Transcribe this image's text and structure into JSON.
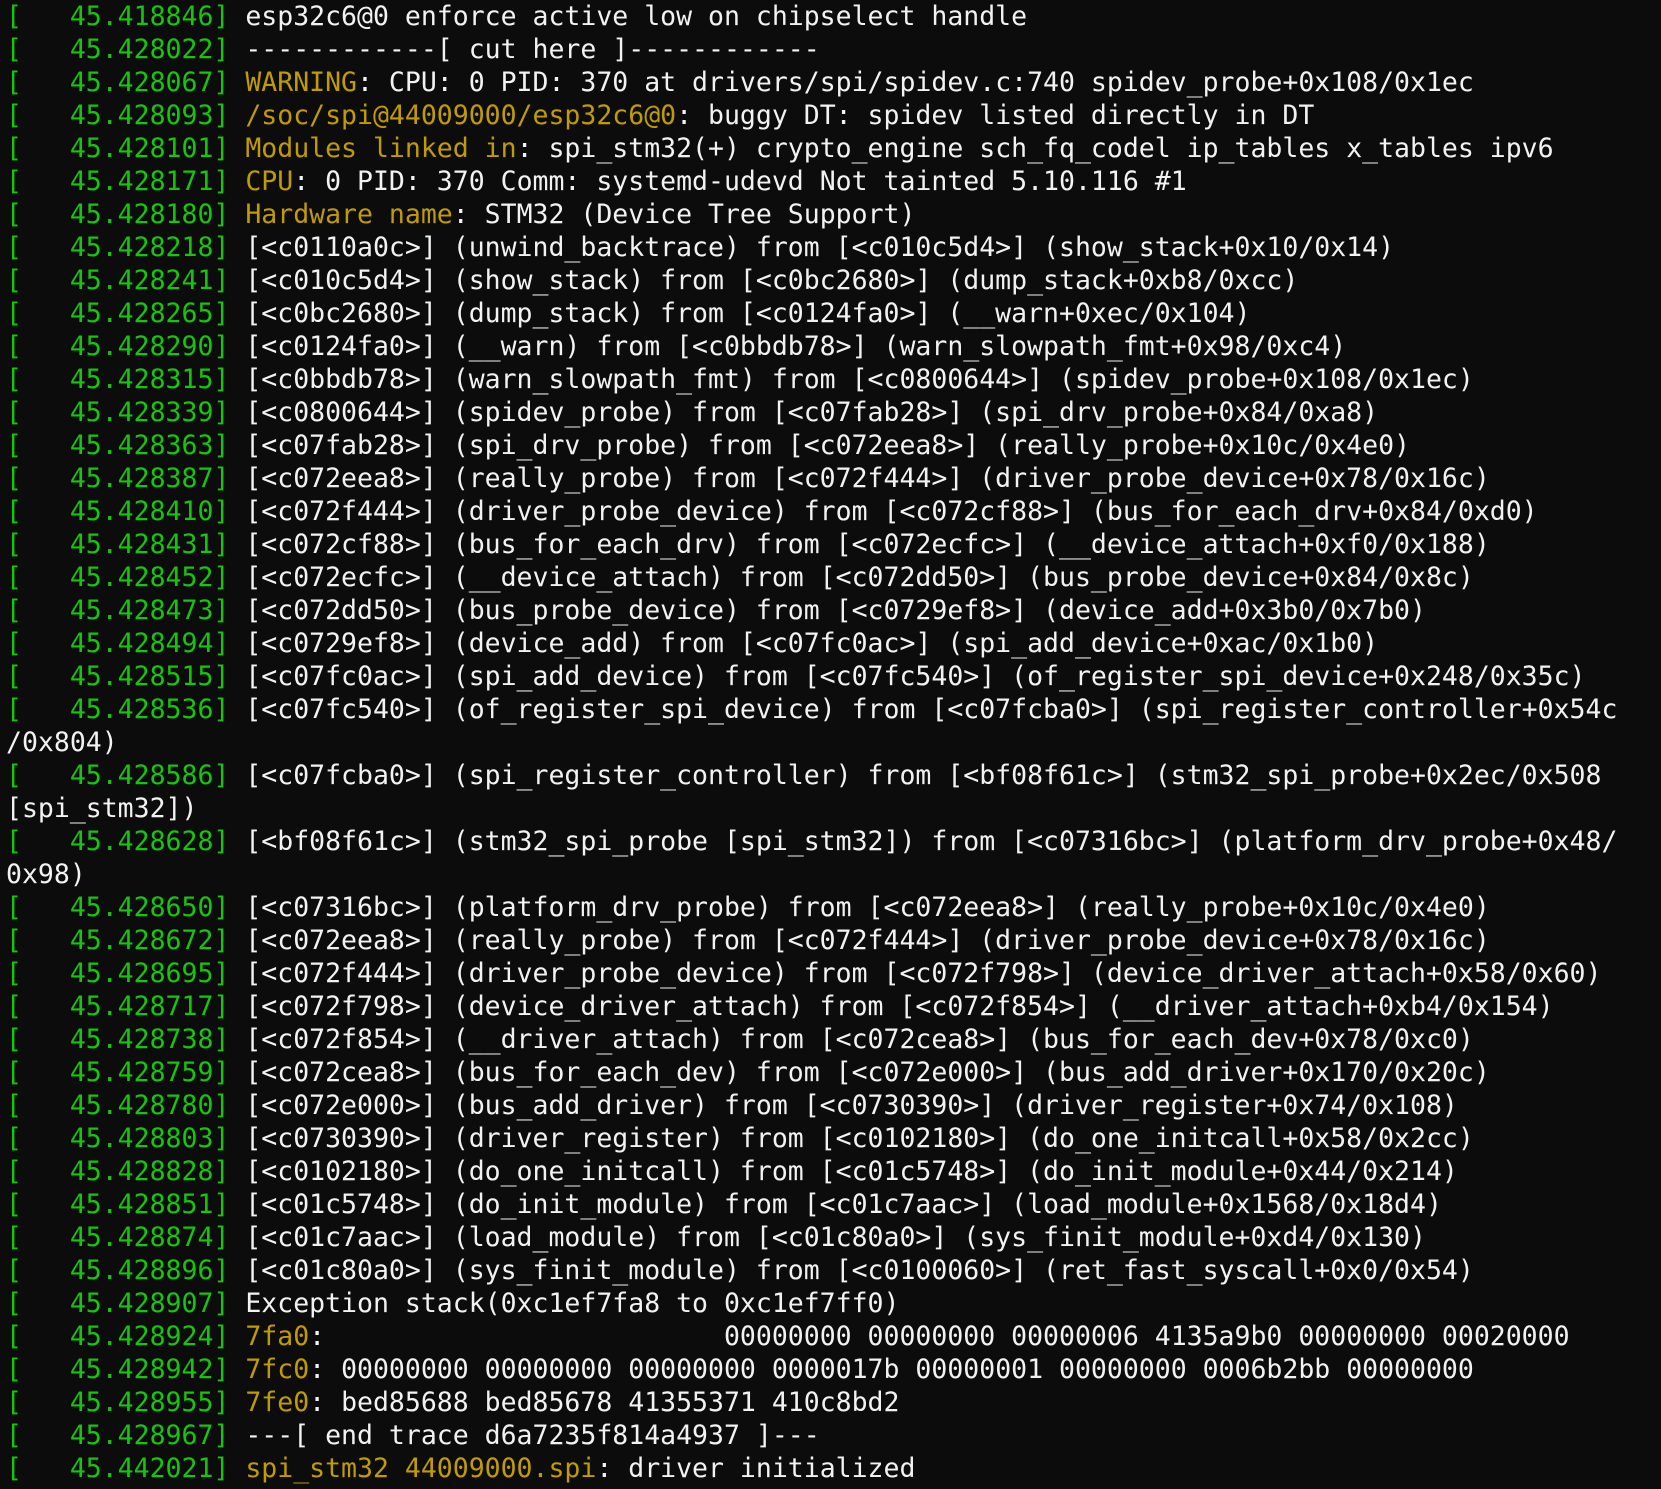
{
  "colors": {
    "background": "#0c0c0c",
    "timestamp": "#16c60c",
    "highlight": "#c19c00",
    "text": "#f2f2f2"
  },
  "lines": [
    {
      "ts": "[   45.418846]",
      "hl": "",
      "tx": " esp32c6@0 enforce active low on chipselect handle"
    },
    {
      "ts": "[   45.428022]",
      "hl": "",
      "tx": " ------------[ cut here ]------------"
    },
    {
      "ts": "[   45.428067]",
      "hl": " WARNING",
      "tx": ": CPU: 0 PID: 370 at drivers/spi/spidev.c:740 spidev_probe+0x108/0x1ec"
    },
    {
      "ts": "[   45.428093]",
      "hl": " /soc/spi@44009000/esp32c6@0",
      "tx": ": buggy DT: spidev listed directly in DT"
    },
    {
      "ts": "[   45.428101]",
      "hl": " Modules linked in",
      "tx": ": spi_stm32(+) crypto_engine sch_fq_codel ip_tables x_tables ipv6"
    },
    {
      "ts": "[   45.428171]",
      "hl": " CPU",
      "tx": ": 0 PID: 370 Comm: systemd-udevd Not tainted 5.10.116 #1"
    },
    {
      "ts": "[   45.428180]",
      "hl": " Hardware name",
      "tx": ": STM32 (Device Tree Support)"
    },
    {
      "ts": "[   45.428218]",
      "hl": "",
      "tx": " [<c0110a0c>] (unwind_backtrace) from [<c010c5d4>] (show_stack+0x10/0x14)"
    },
    {
      "ts": "[   45.428241]",
      "hl": "",
      "tx": " [<c010c5d4>] (show_stack) from [<c0bc2680>] (dump_stack+0xb8/0xcc)"
    },
    {
      "ts": "[   45.428265]",
      "hl": "",
      "tx": " [<c0bc2680>] (dump_stack) from [<c0124fa0>] (__warn+0xec/0x104)"
    },
    {
      "ts": "[   45.428290]",
      "hl": "",
      "tx": " [<c0124fa0>] (__warn) from [<c0bbdb78>] (warn_slowpath_fmt+0x98/0xc4)"
    },
    {
      "ts": "[   45.428315]",
      "hl": "",
      "tx": " [<c0bbdb78>] (warn_slowpath_fmt) from [<c0800644>] (spidev_probe+0x108/0x1ec)"
    },
    {
      "ts": "[   45.428339]",
      "hl": "",
      "tx": " [<c0800644>] (spidev_probe) from [<c07fab28>] (spi_drv_probe+0x84/0xa8)"
    },
    {
      "ts": "[   45.428363]",
      "hl": "",
      "tx": " [<c07fab28>] (spi_drv_probe) from [<c072eea8>] (really_probe+0x10c/0x4e0)"
    },
    {
      "ts": "[   45.428387]",
      "hl": "",
      "tx": " [<c072eea8>] (really_probe) from [<c072f444>] (driver_probe_device+0x78/0x16c)"
    },
    {
      "ts": "[   45.428410]",
      "hl": "",
      "tx": " [<c072f444>] (driver_probe_device) from [<c072cf88>] (bus_for_each_drv+0x84/0xd0)"
    },
    {
      "ts": "[   45.428431]",
      "hl": "",
      "tx": " [<c072cf88>] (bus_for_each_drv) from [<c072ecfc>] (__device_attach+0xf0/0x188)"
    },
    {
      "ts": "[   45.428452]",
      "hl": "",
      "tx": " [<c072ecfc>] (__device_attach) from [<c072dd50>] (bus_probe_device+0x84/0x8c)"
    },
    {
      "ts": "[   45.428473]",
      "hl": "",
      "tx": " [<c072dd50>] (bus_probe_device) from [<c0729ef8>] (device_add+0x3b0/0x7b0)"
    },
    {
      "ts": "[   45.428494]",
      "hl": "",
      "tx": " [<c0729ef8>] (device_add) from [<c07fc0ac>] (spi_add_device+0xac/0x1b0)"
    },
    {
      "ts": "[   45.428515]",
      "hl": "",
      "tx": " [<c07fc0ac>] (spi_add_device) from [<c07fc540>] (of_register_spi_device+0x248/0x35c)"
    },
    {
      "ts": "[   45.428536]",
      "hl": "",
      "tx": " [<c07fc540>] (of_register_spi_device) from [<c07fcba0>] (spi_register_controller+0x54c"
    },
    {
      "ts": "",
      "hl": "",
      "tx": "/0x804)"
    },
    {
      "ts": "[   45.428586]",
      "hl": "",
      "tx": " [<c07fcba0>] (spi_register_controller) from [<bf08f61c>] (stm32_spi_probe+0x2ec/0x508"
    },
    {
      "ts": "",
      "hl": "",
      "tx": "[spi_stm32])"
    },
    {
      "ts": "[   45.428628]",
      "hl": "",
      "tx": " [<bf08f61c>] (stm32_spi_probe [spi_stm32]) from [<c07316bc>] (platform_drv_probe+0x48/"
    },
    {
      "ts": "",
      "hl": "",
      "tx": "0x98)"
    },
    {
      "ts": "[   45.428650]",
      "hl": "",
      "tx": " [<c07316bc>] (platform_drv_probe) from [<c072eea8>] (really_probe+0x10c/0x4e0)"
    },
    {
      "ts": "[   45.428672]",
      "hl": "",
      "tx": " [<c072eea8>] (really_probe) from [<c072f444>] (driver_probe_device+0x78/0x16c)"
    },
    {
      "ts": "[   45.428695]",
      "hl": "",
      "tx": " [<c072f444>] (driver_probe_device) from [<c072f798>] (device_driver_attach+0x58/0x60)"
    },
    {
      "ts": "[   45.428717]",
      "hl": "",
      "tx": " [<c072f798>] (device_driver_attach) from [<c072f854>] (__driver_attach+0xb4/0x154)"
    },
    {
      "ts": "[   45.428738]",
      "hl": "",
      "tx": " [<c072f854>] (__driver_attach) from [<c072cea8>] (bus_for_each_dev+0x78/0xc0)"
    },
    {
      "ts": "[   45.428759]",
      "hl": "",
      "tx": " [<c072cea8>] (bus_for_each_dev) from [<c072e000>] (bus_add_driver+0x170/0x20c)"
    },
    {
      "ts": "[   45.428780]",
      "hl": "",
      "tx": " [<c072e000>] (bus_add_driver) from [<c0730390>] (driver_register+0x74/0x108)"
    },
    {
      "ts": "[   45.428803]",
      "hl": "",
      "tx": " [<c0730390>] (driver_register) from [<c0102180>] (do_one_initcall+0x58/0x2cc)"
    },
    {
      "ts": "[   45.428828]",
      "hl": "",
      "tx": " [<c0102180>] (do_one_initcall) from [<c01c5748>] (do_init_module+0x44/0x214)"
    },
    {
      "ts": "[   45.428851]",
      "hl": "",
      "tx": " [<c01c5748>] (do_init_module) from [<c01c7aac>] (load_module+0x1568/0x18d4)"
    },
    {
      "ts": "[   45.428874]",
      "hl": "",
      "tx": " [<c01c7aac>] (load_module) from [<c01c80a0>] (sys_finit_module+0xd4/0x130)"
    },
    {
      "ts": "[   45.428896]",
      "hl": "",
      "tx": " [<c01c80a0>] (sys_finit_module) from [<c0100060>] (ret_fast_syscall+0x0/0x54)"
    },
    {
      "ts": "[   45.428907]",
      "hl": "",
      "tx": " Exception stack(0xc1ef7fa8 to 0xc1ef7ff0)"
    },
    {
      "ts": "[   45.428924]",
      "hl": " 7fa0",
      "tx": ":                         00000000 00000000 00000006 4135a9b0 00000000 00020000"
    },
    {
      "ts": "[   45.428942]",
      "hl": " 7fc0",
      "tx": ": 00000000 00000000 00000000 0000017b 00000001 00000000 0006b2bb 00000000"
    },
    {
      "ts": "[   45.428955]",
      "hl": " 7fe0",
      "tx": ": bed85688 bed85678 41355371 410c8bd2"
    },
    {
      "ts": "[   45.428967]",
      "hl": "",
      "tx": " ---[ end trace d6a7235f814a4937 ]---"
    },
    {
      "ts": "[   45.442021]",
      "hl": " spi_stm32 44009000.spi",
      "tx": ": driver initialized"
    }
  ]
}
